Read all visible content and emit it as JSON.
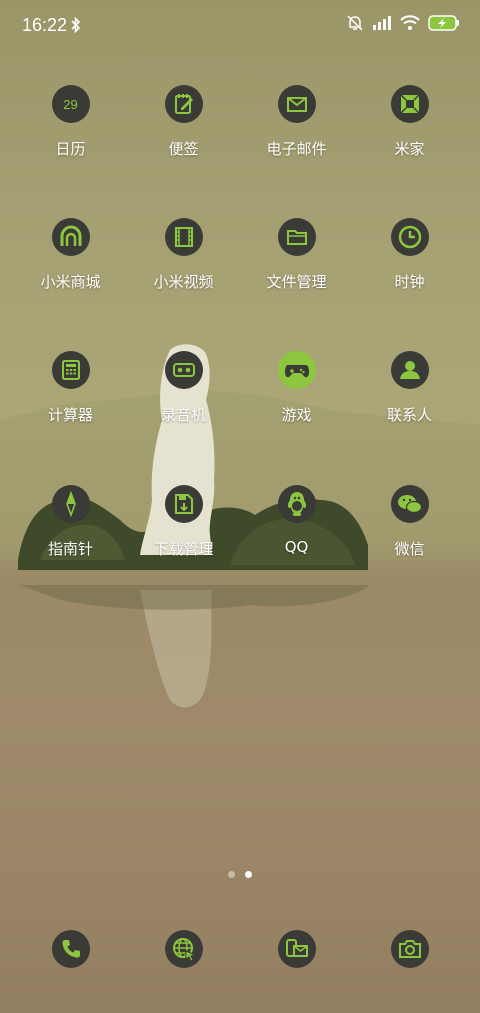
{
  "status": {
    "time": "16:22",
    "icons": [
      "bluetooth-icon",
      "mute-alarm-icon",
      "signal-icon",
      "wifi-icon",
      "battery-charging-icon"
    ]
  },
  "accent": "#8dc63f",
  "apps": [
    {
      "label": "日历",
      "icon": "calendar-icon",
      "badge": "29"
    },
    {
      "label": "便签",
      "icon": "notes-icon"
    },
    {
      "label": "电子邮件",
      "icon": "email-icon"
    },
    {
      "label": "米家",
      "icon": "mijia-icon"
    },
    {
      "label": "小米商城",
      "icon": "mi-store-icon"
    },
    {
      "label": "小米视频",
      "icon": "video-icon"
    },
    {
      "label": "文件管理",
      "icon": "folder-icon"
    },
    {
      "label": "时钟",
      "icon": "clock-icon"
    },
    {
      "label": "计算器",
      "icon": "calculator-icon"
    },
    {
      "label": "录音机",
      "icon": "recorder-icon"
    },
    {
      "label": "游戏",
      "icon": "gamepad-icon"
    },
    {
      "label": "联系人",
      "icon": "contacts-icon"
    },
    {
      "label": "指南针",
      "icon": "compass-icon"
    },
    {
      "label": "下载管理",
      "icon": "download-icon"
    },
    {
      "label": "QQ",
      "icon": "qq-icon"
    },
    {
      "label": "微信",
      "icon": "wechat-icon"
    }
  ],
  "dock": [
    {
      "icon": "phone-icon"
    },
    {
      "icon": "browser-icon"
    },
    {
      "icon": "messages-icon"
    },
    {
      "icon": "camera-icon"
    }
  ],
  "pages": {
    "count": 2,
    "active": 2
  }
}
